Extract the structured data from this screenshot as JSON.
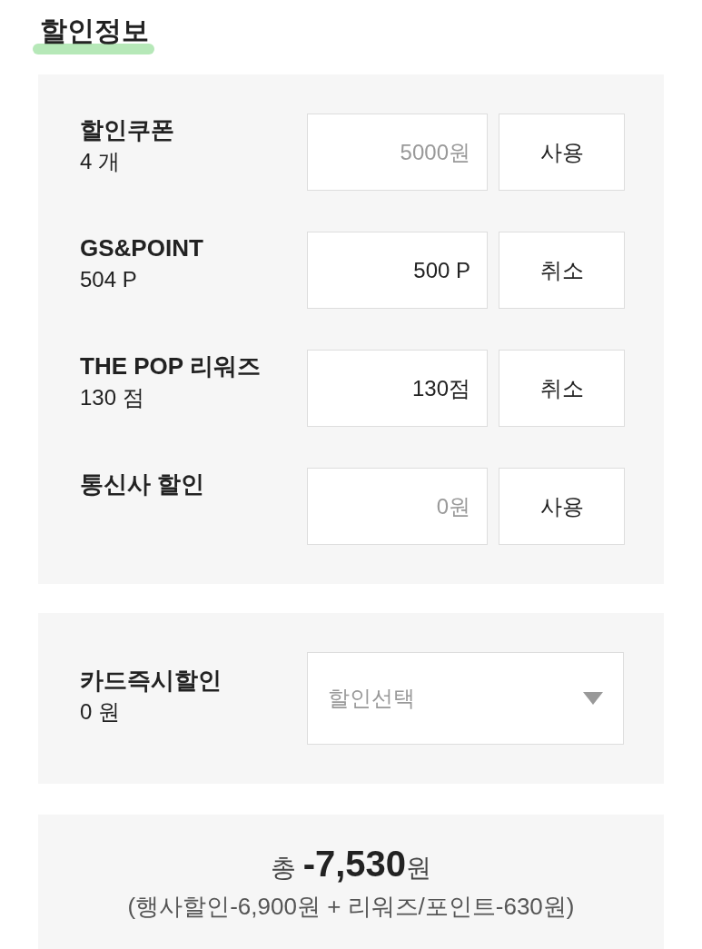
{
  "title": "할인정보",
  "discounts": [
    {
      "label": "할인쿠폰",
      "sub": "4 개",
      "placeholder": "5000원",
      "button": "사용"
    },
    {
      "label": "GS&POINT",
      "sub": "504 P",
      "value": "500 P",
      "button": "취소"
    },
    {
      "label": "THE POP 리워즈",
      "sub": "130 점",
      "value": "130점",
      "button": "취소"
    },
    {
      "label": "통신사 할인",
      "placeholder": "0원",
      "button": "사용"
    }
  ],
  "card_discount": {
    "label": "카드즉시할인",
    "sub": "0 원",
    "select_placeholder": "할인선택"
  },
  "total": {
    "line": "총 **-7,530**원",
    "detail": "(행사할인-6,900원 + 리워즈/포인트-630원)"
  }
}
